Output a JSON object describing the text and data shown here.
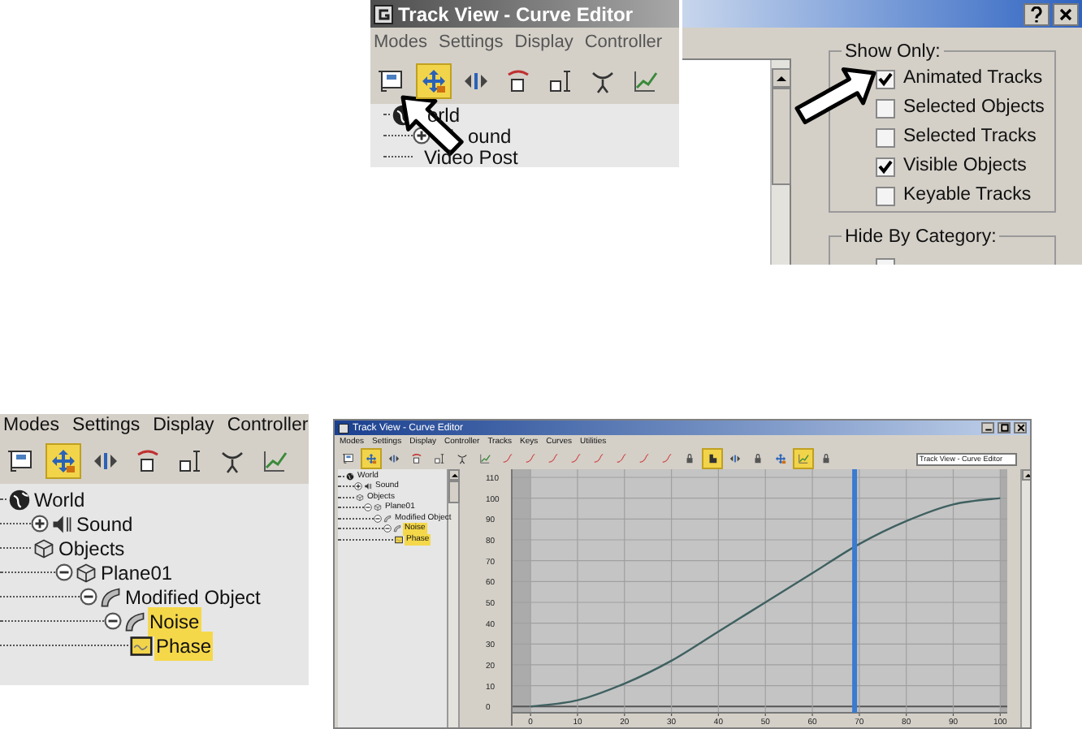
{
  "track_view_crop": {
    "title": "Track View - Curve Editor",
    "menu": [
      "Modes",
      "Settings",
      "Display",
      "Controller"
    ],
    "toolbar": [
      {
        "kind": "filter",
        "selected": false
      },
      {
        "kind": "move",
        "selected": true
      },
      {
        "kind": "slide",
        "selected": false
      },
      {
        "kind": "scale_keys",
        "selected": false
      },
      {
        "kind": "scale_values",
        "selected": false
      },
      {
        "kind": "ease",
        "selected": false
      },
      {
        "kind": "curve",
        "selected": false
      }
    ],
    "tree": [
      {
        "label": "orld",
        "kind": "world",
        "selected": false,
        "children": [
          {
            "label": "ound",
            "kind": "sound",
            "selected": false,
            "expanded": false
          },
          {
            "label": "Video Post",
            "kind": "none",
            "selected": false
          }
        ]
      }
    ]
  },
  "filter_dialog": {
    "show_only": {
      "title": "Show Only:",
      "options": [
        {
          "label": "Animated Tracks",
          "checked": true
        },
        {
          "label": "Selected Objects",
          "checked": false
        },
        {
          "label": "Selected Tracks",
          "checked": false
        },
        {
          "label": "Visible Objects",
          "checked": true
        },
        {
          "label": "Keyable Tracks",
          "checked": false
        }
      ]
    },
    "hide_by_category": {
      "title": "Hide By Category:",
      "options": [
        {
          "checked": false
        }
      ]
    }
  },
  "controller_tree_crop": {
    "menu": [
      "Modes",
      "Settings",
      "Display",
      "Controller"
    ],
    "toolbar": [
      {
        "kind": "filter",
        "selected": false
      },
      {
        "kind": "move",
        "selected": true
      },
      {
        "kind": "slide",
        "selected": false
      },
      {
        "kind": "scale_keys",
        "selected": false
      },
      {
        "kind": "scale_values",
        "selected": false
      },
      {
        "kind": "ease",
        "selected": false
      },
      {
        "kind": "curve",
        "selected": false
      }
    ],
    "tree": [
      {
        "label": "World",
        "kind": "world",
        "selected": false,
        "children": [
          {
            "label": "Sound",
            "kind": "sound",
            "selected": false,
            "expanded": false
          },
          {
            "label": "Objects",
            "kind": "objects",
            "selected": false,
            "children": [
              {
                "label": "Plane01",
                "kind": "object",
                "selected": false,
                "expanded": true,
                "children": [
                  {
                    "label": "Modified Object",
                    "kind": "modifier",
                    "selected": false,
                    "expanded": true,
                    "children": [
                      {
                        "label": "Noise",
                        "kind": "modifier",
                        "selected": true,
                        "expanded": true,
                        "children": [
                          {
                            "label": "Phase",
                            "kind": "controller",
                            "selected": true
                          }
                        ]
                      }
                    ]
                  }
                ]
              }
            ]
          }
        ]
      }
    ]
  },
  "curve_editor_window": {
    "title": "Track View - Curve Editor",
    "menu": [
      "Modes",
      "Settings",
      "Display",
      "Controller",
      "Tracks",
      "Keys",
      "Curves",
      "Utilities"
    ],
    "toolbar": [
      {
        "kind": "filter",
        "selected": false
      },
      {
        "kind": "move",
        "selected": true
      },
      {
        "kind": "slide",
        "selected": false
      },
      {
        "kind": "scale_keys",
        "selected": false
      },
      {
        "kind": "scale_values",
        "selected": false
      },
      {
        "kind": "ease",
        "selected": false
      },
      {
        "kind": "curve",
        "selected": false
      },
      {
        "kind": "tangent",
        "selected": false
      },
      {
        "kind": "tangent",
        "selected": false
      },
      {
        "kind": "tangent",
        "selected": false
      },
      {
        "kind": "tangent",
        "selected": false
      },
      {
        "kind": "tangent",
        "selected": false
      },
      {
        "kind": "tangent",
        "selected": false
      },
      {
        "kind": "tangent",
        "selected": false
      },
      {
        "kind": "tangent",
        "selected": false
      },
      {
        "kind": "lock",
        "selected": false
      },
      {
        "kind": "snap",
        "selected": true
      },
      {
        "kind": "slide",
        "selected": false
      },
      {
        "kind": "lock",
        "selected": false
      },
      {
        "kind": "move",
        "selected": false
      },
      {
        "kind": "curve",
        "selected": true
      },
      {
        "kind": "lock",
        "selected": false
      }
    ],
    "name_field": {
      "value": "Track View - Curve Editor"
    },
    "tree": [
      {
        "label": "World",
        "kind": "world",
        "selected": false,
        "children": [
          {
            "label": "Sound",
            "kind": "sound",
            "selected": false,
            "expanded": false
          },
          {
            "label": "Objects",
            "kind": "objects",
            "selected": false,
            "children": [
              {
                "label": "Plane01",
                "kind": "object",
                "selected": false,
                "expanded": true,
                "children": [
                  {
                    "label": "Modified Object",
                    "kind": "modifier",
                    "selected": false,
                    "expanded": true,
                    "children": [
                      {
                        "label": "Noise",
                        "kind": "modifier",
                        "selected": true,
                        "expanded": true,
                        "children": [
                          {
                            "label": "Phase",
                            "kind": "controller",
                            "selected": true
                          }
                        ]
                      }
                    ]
                  }
                ]
              }
            ]
          }
        ]
      }
    ],
    "chart_data": {
      "type": "line",
      "x": [
        0,
        10,
        20,
        30,
        40,
        50,
        60,
        70,
        80,
        90,
        100
      ],
      "series": [
        {
          "color": "#3f6060",
          "values": [
            0,
            3,
            11,
            22,
            36,
            50,
            64,
            78,
            89,
            97,
            100
          ]
        }
      ],
      "xlim": [
        -4,
        101.5
      ],
      "ylim": [
        -3,
        110
      ],
      "xticks": [
        0,
        10,
        20,
        30,
        40,
        50,
        60,
        70,
        80,
        90,
        100
      ],
      "yticks": [
        0,
        10,
        20,
        30,
        40,
        50,
        60,
        70,
        80,
        90,
        100,
        110
      ],
      "grid": true,
      "ref_lines": [
        {
          "axis": "x",
          "value": 69,
          "color": "#3a7ad0"
        }
      ],
      "bands": [
        {
          "axis": "x",
          "from": -4,
          "to": 0,
          "color": "#ababab"
        },
        {
          "axis": "x",
          "from": 100,
          "to": 101.5,
          "color": "#ababab"
        }
      ]
    }
  }
}
